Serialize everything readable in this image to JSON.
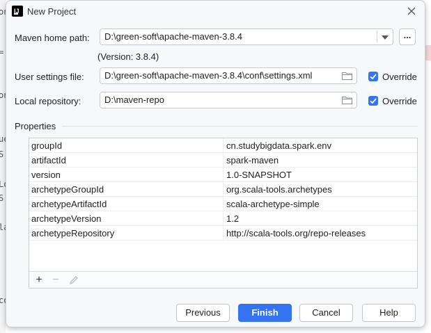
{
  "dialog": {
    "title": "New Project",
    "app_icon": "intellij-idea-icon"
  },
  "maven_home": {
    "label": "Maven home path:",
    "value": "D:\\green-soft\\apache-maven-3.8.4",
    "browse_label": "...",
    "version": "(Version: 3.8.4)"
  },
  "user_settings": {
    "label": "User settings file:",
    "value": "D:\\green-soft\\apache-maven-3.8.4\\conf\\settings.xml",
    "override_label": "Override",
    "override_checked": true
  },
  "local_repo": {
    "label": "Local repository:",
    "value": "D:\\maven-repo",
    "override_label": "Override",
    "override_checked": true
  },
  "properties": {
    "title": "Properties",
    "rows": [
      {
        "key": "groupId",
        "value": "cn.studybigdata.spark.env"
      },
      {
        "key": "artifactId",
        "value": "spark-maven"
      },
      {
        "key": "version",
        "value": "1.0-SNAPSHOT"
      },
      {
        "key": "archetypeGroupId",
        "value": "org.scala-tools.archetypes"
      },
      {
        "key": "archetypeArtifactId",
        "value": "scala-archetype-simple"
      },
      {
        "key": "archetypeVersion",
        "value": "1.2"
      },
      {
        "key": "archetypeRepository",
        "value": "http://scala-tools.org/repo-releases"
      }
    ],
    "toolbar": {
      "add": "+",
      "remove": "−"
    }
  },
  "buttons": {
    "previous": "Previous",
    "finish": "Finish",
    "cancel": "Cancel",
    "help": "Help"
  },
  "colors": {
    "accent": "#3574f0",
    "dialog_bg": "#f7f8fa"
  },
  "background_fragments": [
    "on",
    "=",
    "on",
    "ue",
    "S",
    "Lo",
    "S",
    "la",
    "co"
  ]
}
